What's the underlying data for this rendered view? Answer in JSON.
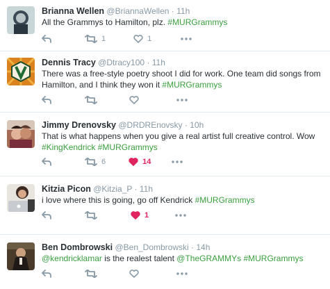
{
  "colors": {
    "text": "#292f33",
    "muted": "#8899a6",
    "hashtag": "#3a9e3e",
    "like_active": "#e0245e",
    "divider": "#e1e8ed"
  },
  "tweets": [
    {
      "name": "Brianna Wellen",
      "handle": "@BriannaWellen",
      "dot": "·",
      "time": "11h",
      "text_plain": "All the Grammys to Hamilton, plz. ",
      "hashtag": "#MURGrammys",
      "retweet_count": "1",
      "like_count": "1",
      "liked": false
    },
    {
      "name": "Dennis Tracy",
      "handle": "@Dtracy100",
      "dot": "·",
      "time": "11h",
      "text_plain": "There was a free-style poetry shoot I did for work. One team did songs from Hamilton, and I think they won it ",
      "hashtag": "#MURGrammys",
      "retweet_count": "",
      "like_count": "",
      "liked": false
    },
    {
      "name": "Jimmy Drenovsky",
      "handle": "@DRDREnovsky",
      "dot": "·",
      "time": "10h",
      "text_plain": "That is what happens when you give a real artist full creative control. Wow ",
      "hashtag1": "#KingKendrick",
      "hashtag": "#MURGrammys",
      "retweet_count": "6",
      "like_count": "14",
      "liked": true
    },
    {
      "name": "Kitzia Picon",
      "handle": "@Kitzia_P",
      "dot": "·",
      "time": "11h",
      "text_plain": "i love where this is going, go off Kendrick ",
      "hashtag": "#MURGrammys",
      "retweet_count": "",
      "like_count": "1",
      "liked": true
    },
    {
      "name": "Ben Dombrowski",
      "handle": "@Ben_Dombrowski",
      "dot": "·",
      "time": "14h",
      "mention1": "@kendricklamar",
      "text_mid": " is the realest talent ",
      "mention2": "@TheGRAMMYs",
      "text_space": " ",
      "hashtag": "#MURGrammys",
      "retweet_count": "",
      "like_count": "",
      "liked": false
    }
  ],
  "icons": {
    "reply": "reply-icon",
    "retweet": "retweet-icon",
    "like": "heart-icon",
    "more": "more-icon"
  }
}
